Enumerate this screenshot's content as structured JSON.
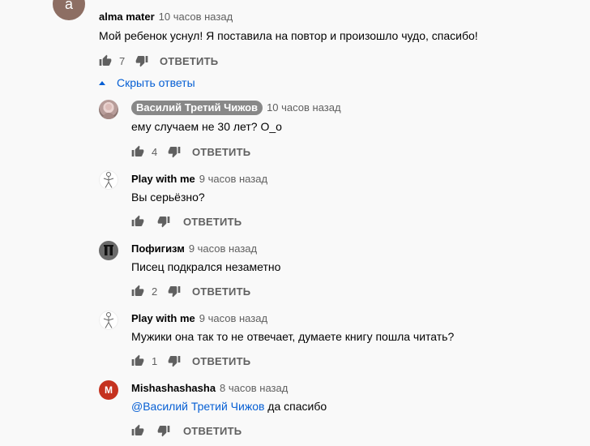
{
  "top_comment": {
    "avatar_letter": "a",
    "author": "alma mater",
    "time": "10 часов назад",
    "text": "Мой ребенок уснул! Я поставила на повтор и произошло чудо, спасибо!",
    "likes": "7",
    "reply_label": "ОТВЕТИТЬ"
  },
  "toggle_label": "Скрыть ответы",
  "replies": [
    {
      "author": "Василий Третий Чижов",
      "time": "10 часов назад",
      "text": "ему случаем не 30 лет? O_o",
      "likes": "4",
      "reply_label": "ОТВЕТИТЬ",
      "avatar": "photo-avatar"
    },
    {
      "author": "Play with me",
      "time": "9 часов назад",
      "text": "Вы серьёзно?",
      "likes": "",
      "reply_label": "ОТВЕТИТЬ",
      "avatar": "stick-figure-avatar"
    },
    {
      "author": "Пофигизм",
      "time": "9 часов назад",
      "text": "Писец подкрался незаметно",
      "likes": "2",
      "reply_label": "ОТВЕТИТЬ",
      "avatar": "pause-avatar"
    },
    {
      "author": "Play with me",
      "time": "9 часов назад",
      "text": "Мужики она так то не отвечает, думаете книгу пошла читать?",
      "likes": "1",
      "reply_label": "ОТВЕТИТЬ",
      "avatar": "stick-figure-avatar"
    },
    {
      "author": "Mishashashasha",
      "time": "8 часов назад",
      "mention": "@Василий Третий Чижов",
      "text": " да спасибо",
      "likes": "",
      "reply_label": "ОТВЕТИТЬ",
      "avatar_letter": "M"
    }
  ],
  "colors": {
    "link": "#065fd4",
    "muted": "#606060",
    "background": "#f9f9f9",
    "avatar_top": "#8d6e63",
    "avatar_m": "#c5321f"
  }
}
